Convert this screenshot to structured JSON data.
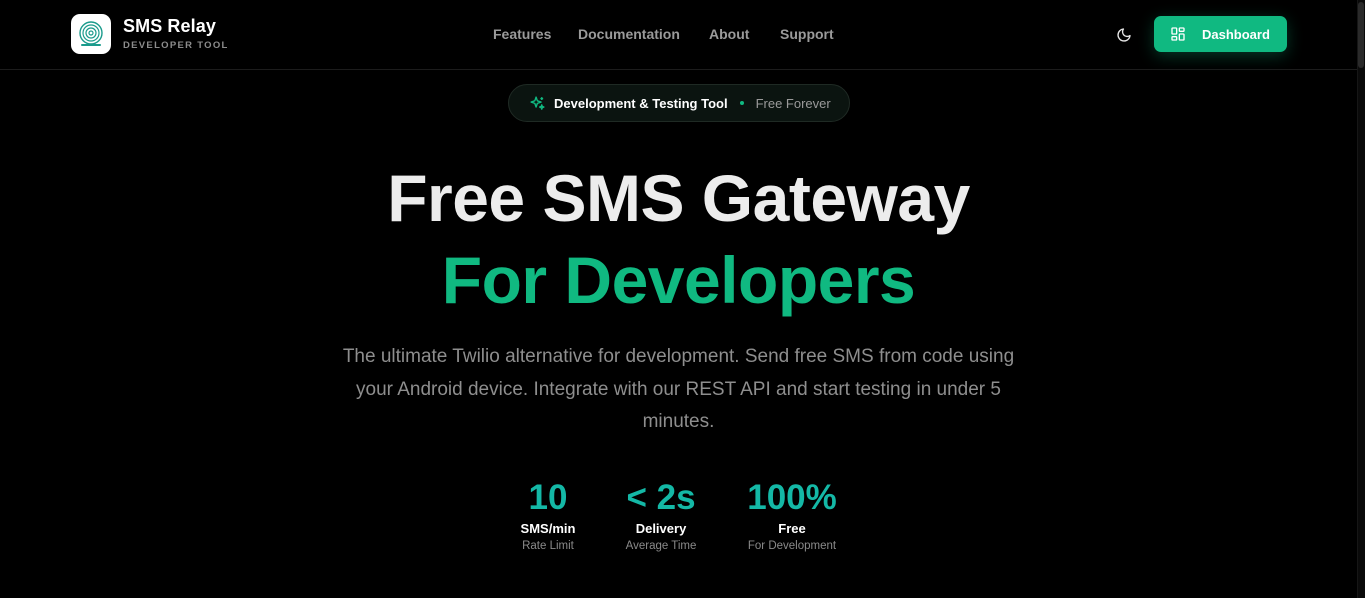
{
  "brand": {
    "title": "SMS Relay",
    "subtitle": "DEVELOPER TOOL"
  },
  "nav": {
    "features": "Features",
    "documentation": "Documentation",
    "about": "About",
    "support": "Support"
  },
  "header": {
    "dashboard_label": "Dashboard"
  },
  "badge": {
    "main": "Development & Testing Tool",
    "sub": "Free Forever"
  },
  "hero": {
    "line1": "Free SMS Gateway",
    "line2": "For Developers",
    "description": "The ultimate Twilio alternative for development. Send free SMS from code using your Android device. Integrate with our REST API and start testing in under 5 minutes."
  },
  "stats": [
    {
      "value": "10",
      "label": "SMS/min",
      "caption": "Rate Limit"
    },
    {
      "value": "< 2s",
      "label": "Delivery",
      "caption": "Average Time"
    },
    {
      "value": "100%",
      "label": "Free",
      "caption": "For Development"
    }
  ],
  "colors": {
    "accent": "#10b981",
    "stat": "#14b8a6",
    "background": "#000000"
  },
  "icons": {
    "theme_toggle": "moon-icon",
    "dashboard": "grid-icon",
    "badge": "sparkles-icon",
    "logo": "fingerprint-logo-icon"
  }
}
